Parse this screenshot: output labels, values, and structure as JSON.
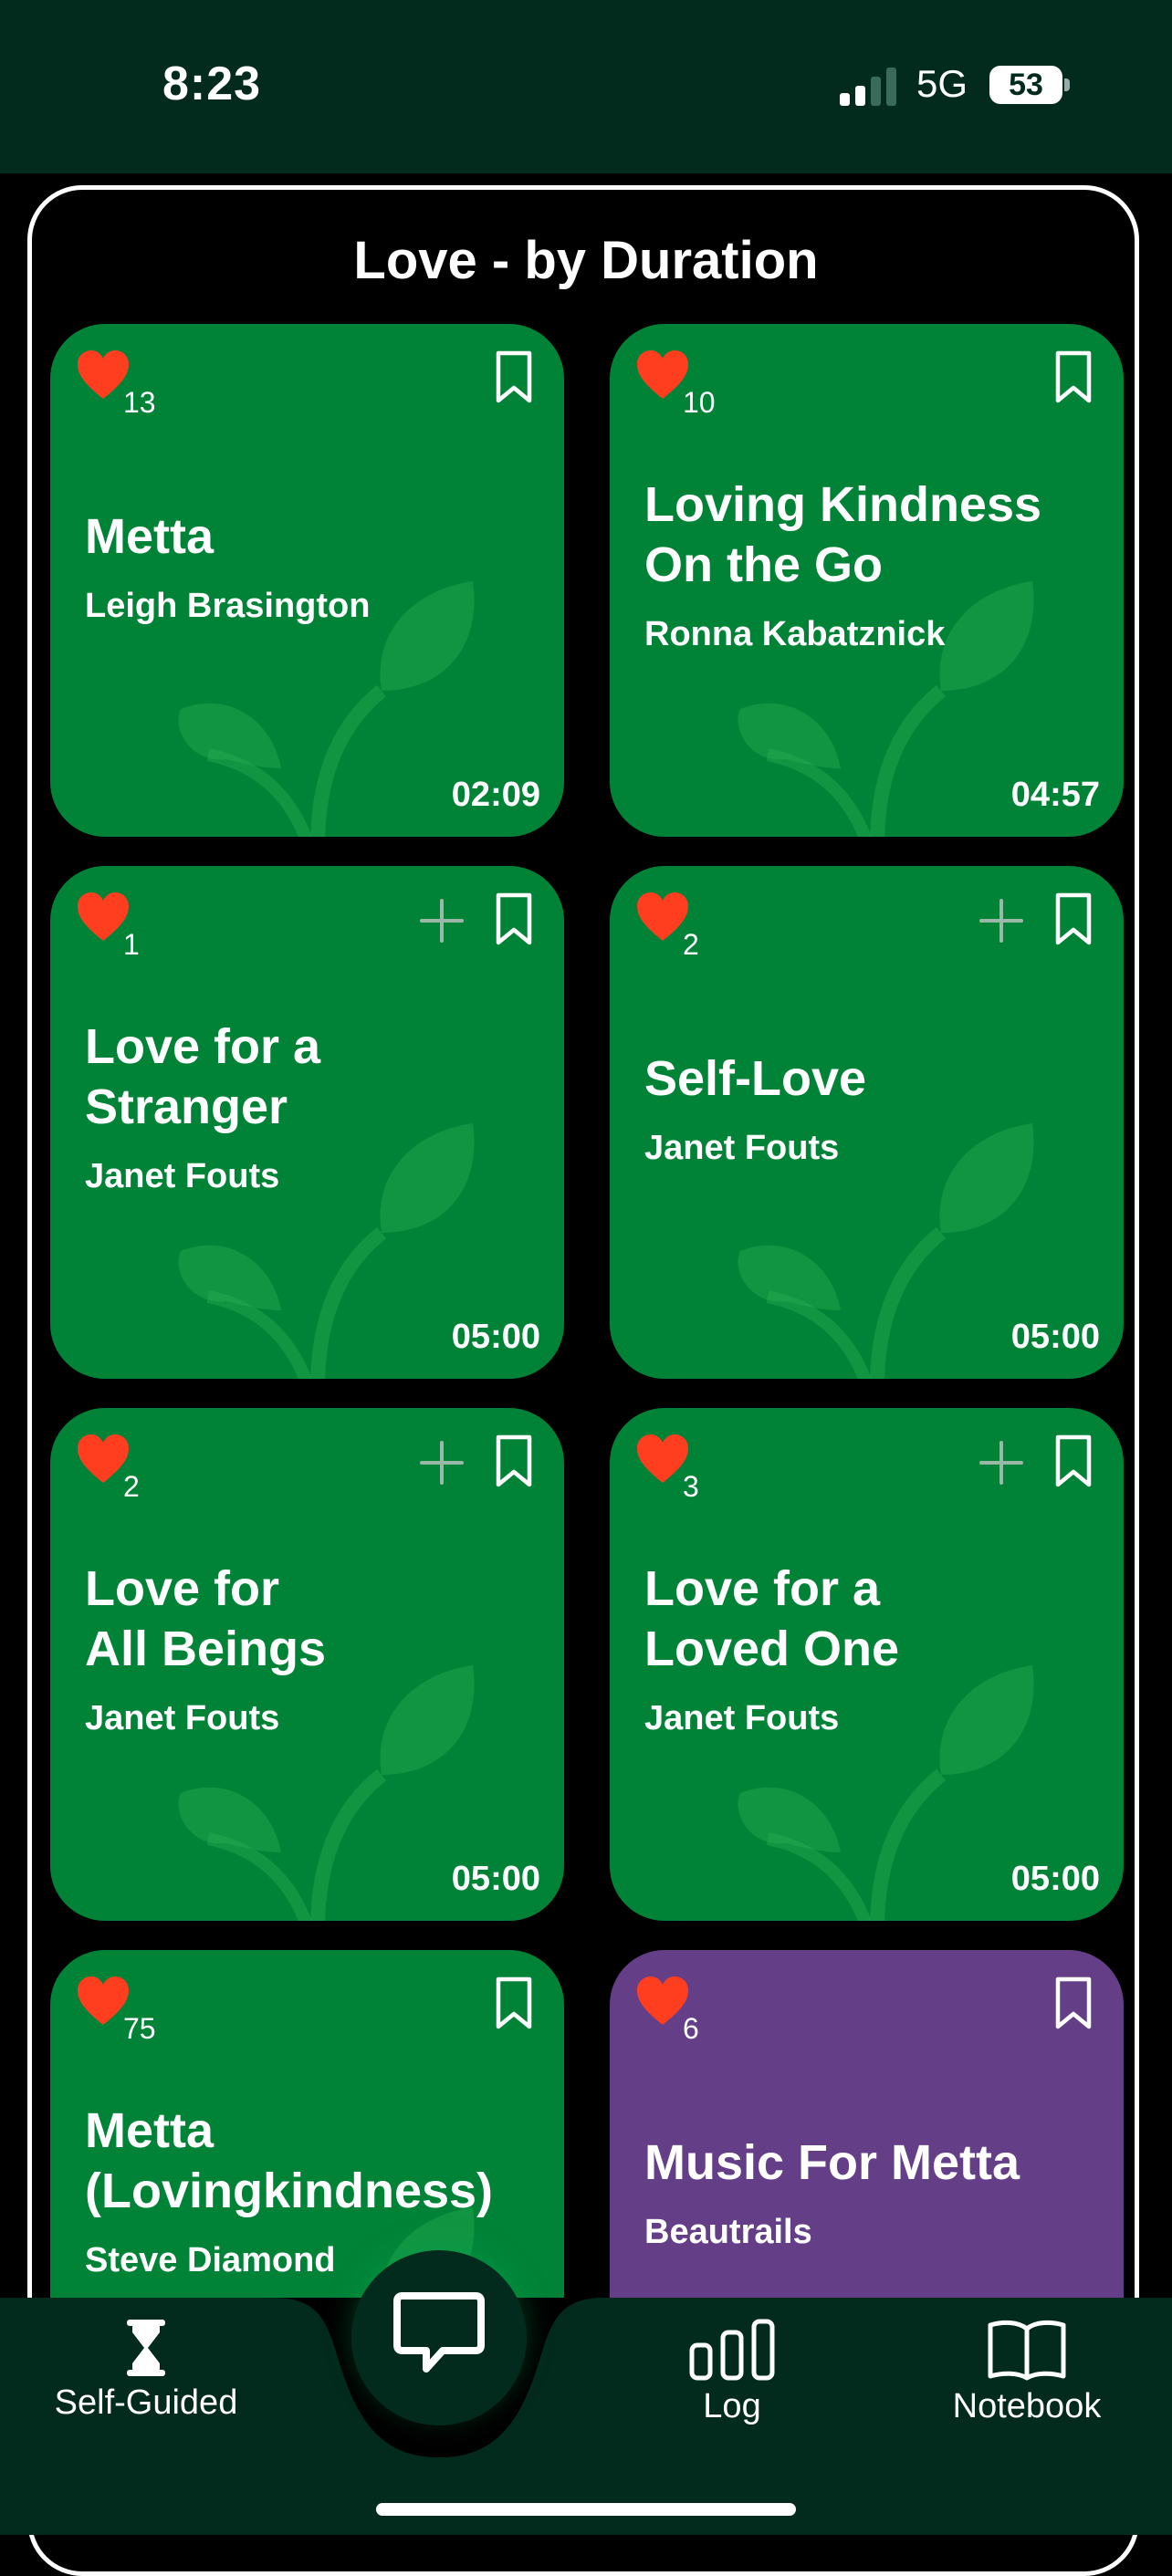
{
  "status": {
    "time": "8:23",
    "network": "5G",
    "battery": "53"
  },
  "page_title": "Love - by Duration",
  "cards": [
    {
      "likes": "13",
      "title": "Metta",
      "author": "Leigh Brasington",
      "duration": "02:09",
      "color": "green",
      "has_plus": false
    },
    {
      "likes": "10",
      "title": "Loving Kindness\nOn the Go",
      "author": "Ronna Kabatznick",
      "duration": "04:57",
      "color": "green",
      "has_plus": false
    },
    {
      "likes": "1",
      "title": "Love for a\nStranger",
      "author": "Janet Fouts",
      "duration": "05:00",
      "color": "green",
      "has_plus": true
    },
    {
      "likes": "2",
      "title": "Self-Love",
      "author": "Janet Fouts",
      "duration": "05:00",
      "color": "green",
      "has_plus": true
    },
    {
      "likes": "2",
      "title": "Love for\nAll Beings",
      "author": "Janet Fouts",
      "duration": "05:00",
      "color": "green",
      "has_plus": true
    },
    {
      "likes": "3",
      "title": "Love for a\nLoved One",
      "author": "Janet Fouts",
      "duration": "05:00",
      "color": "green",
      "has_plus": true
    },
    {
      "likes": "75",
      "title": "Metta\n(Lovingkindness)",
      "author": "Steve Diamond",
      "duration": "",
      "color": "green",
      "has_plus": false
    },
    {
      "likes": "6",
      "title": "Music For Metta",
      "author": "Beautrails",
      "duration": "",
      "color": "purple",
      "has_plus": false
    }
  ],
  "tabs": {
    "self_guided": "Self-Guided",
    "log": "Log",
    "notebook": "Notebook"
  },
  "colors": {
    "card_green": "#018337",
    "card_purple": "#643f88",
    "heart": "#ff3d1f",
    "bar_bg": "#022a1d"
  }
}
